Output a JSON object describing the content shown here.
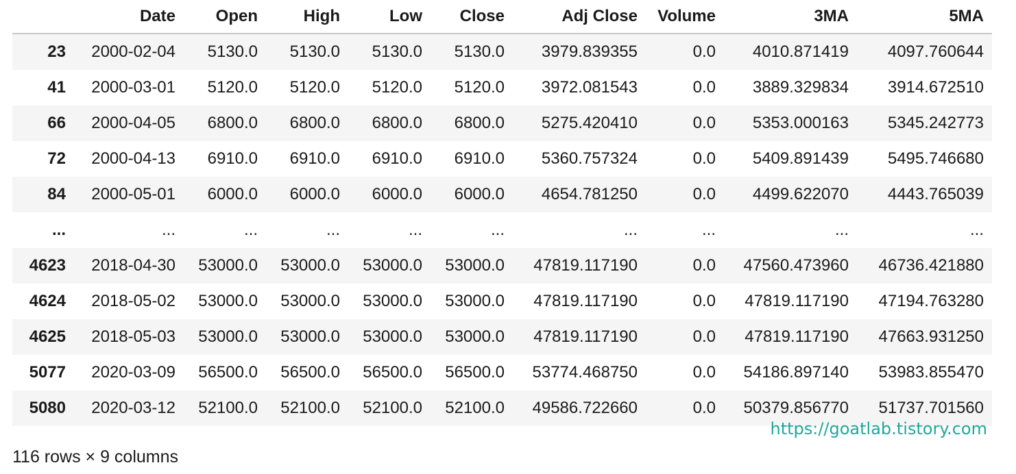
{
  "table": {
    "index_header": "",
    "headers": [
      "Date",
      "Open",
      "High",
      "Low",
      "Close",
      "Adj Close",
      "Volume",
      "3MA",
      "5MA"
    ],
    "rows": [
      {
        "index": "23",
        "cells": [
          "2000-02-04",
          "5130.0",
          "5130.0",
          "5130.0",
          "5130.0",
          "3979.839355",
          "0.0",
          "4010.871419",
          "4097.760644"
        ]
      },
      {
        "index": "41",
        "cells": [
          "2000-03-01",
          "5120.0",
          "5120.0",
          "5120.0",
          "5120.0",
          "3972.081543",
          "0.0",
          "3889.329834",
          "3914.672510"
        ]
      },
      {
        "index": "66",
        "cells": [
          "2000-04-05",
          "6800.0",
          "6800.0",
          "6800.0",
          "6800.0",
          "5275.420410",
          "0.0",
          "5353.000163",
          "5345.242773"
        ]
      },
      {
        "index": "72",
        "cells": [
          "2000-04-13",
          "6910.0",
          "6910.0",
          "6910.0",
          "6910.0",
          "5360.757324",
          "0.0",
          "5409.891439",
          "5495.746680"
        ]
      },
      {
        "index": "84",
        "cells": [
          "2000-05-01",
          "6000.0",
          "6000.0",
          "6000.0",
          "6000.0",
          "4654.781250",
          "0.0",
          "4499.622070",
          "4443.765039"
        ]
      },
      {
        "index": "...",
        "cells": [
          "...",
          "...",
          "...",
          "...",
          "...",
          "...",
          "...",
          "...",
          "..."
        ]
      },
      {
        "index": "4623",
        "cells": [
          "2018-04-30",
          "53000.0",
          "53000.0",
          "53000.0",
          "53000.0",
          "47819.117190",
          "0.0",
          "47560.473960",
          "46736.421880"
        ]
      },
      {
        "index": "4624",
        "cells": [
          "2018-05-02",
          "53000.0",
          "53000.0",
          "53000.0",
          "53000.0",
          "47819.117190",
          "0.0",
          "47819.117190",
          "47194.763280"
        ]
      },
      {
        "index": "4625",
        "cells": [
          "2018-05-03",
          "53000.0",
          "53000.0",
          "53000.0",
          "53000.0",
          "47819.117190",
          "0.0",
          "47819.117190",
          "47663.931250"
        ]
      },
      {
        "index": "5077",
        "cells": [
          "2020-03-09",
          "56500.0",
          "56500.0",
          "56500.0",
          "56500.0",
          "53774.468750",
          "0.0",
          "54186.897140",
          "53983.855470"
        ]
      },
      {
        "index": "5080",
        "cells": [
          "2020-03-12",
          "52100.0",
          "52100.0",
          "52100.0",
          "52100.0",
          "49586.722660",
          "0.0",
          "50379.856770",
          "51737.701560"
        ]
      }
    ]
  },
  "summary": "116 rows × 9 columns",
  "watermark": "https://goatlab.tistory.com",
  "colors": {
    "watermark": "#1aa99a",
    "stripe": "#f5f5f5",
    "header_rule": "#c8c8c8"
  }
}
